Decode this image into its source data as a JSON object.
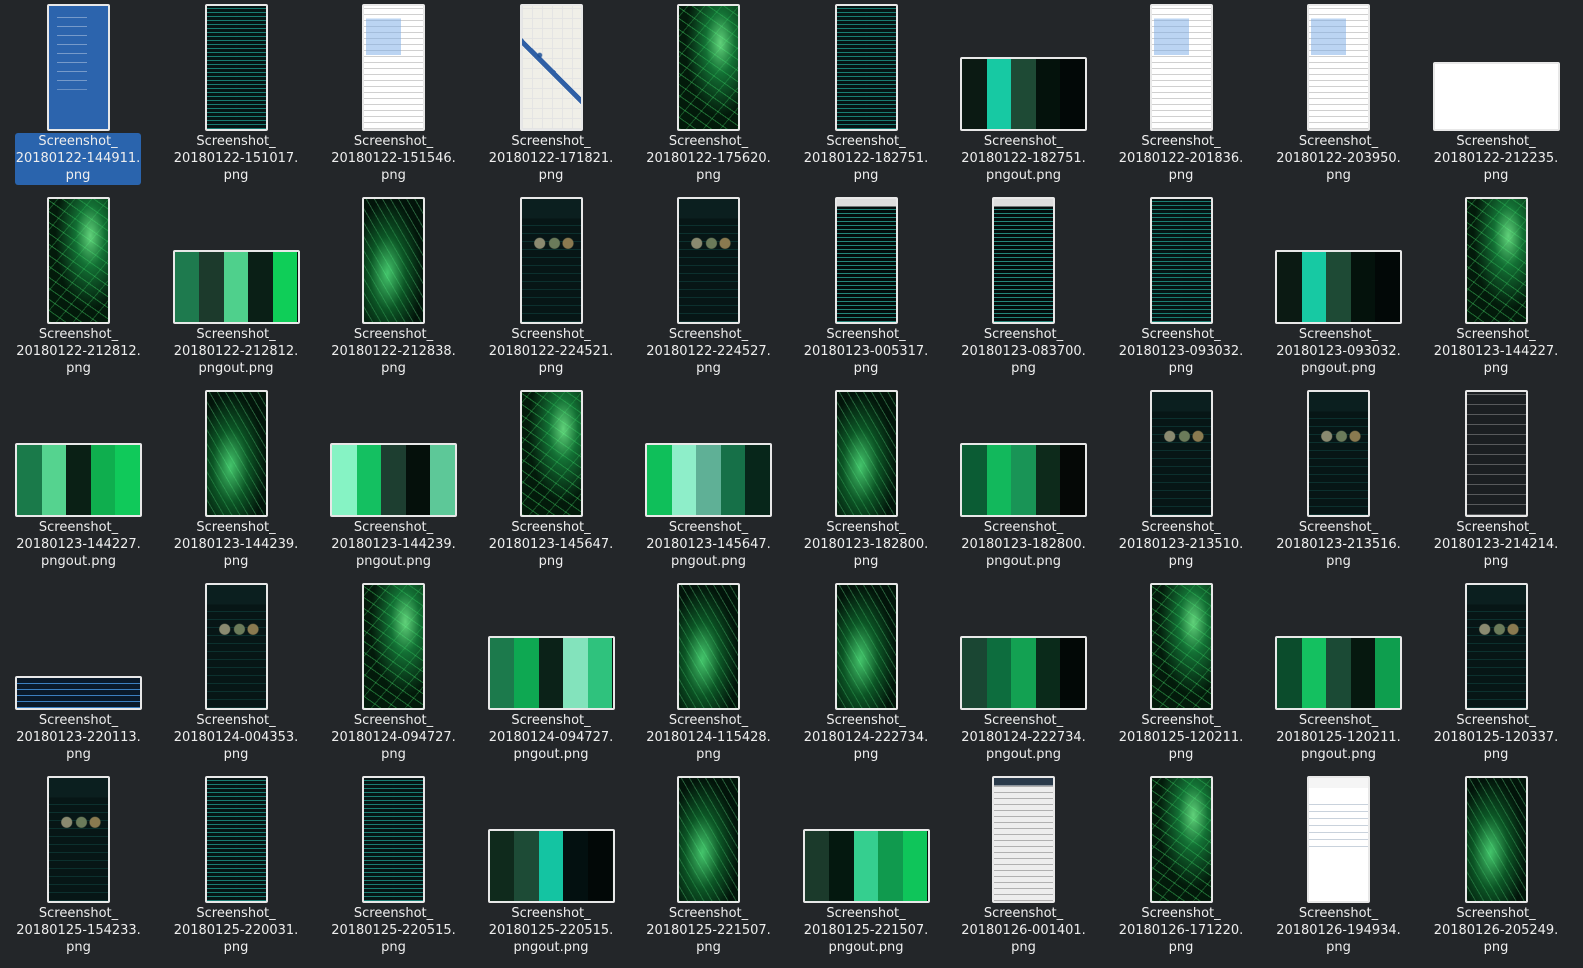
{
  "files": [
    {
      "name": [
        "Screenshot_",
        "20180122-144911.",
        "png"
      ],
      "thumb": "blue",
      "selected": true
    },
    {
      "name": [
        "Screenshot_",
        "20180122-151017.",
        "png"
      ],
      "thumb": "list"
    },
    {
      "name": [
        "Screenshot_",
        "20180122-151546.",
        "png"
      ],
      "thumb": "chartdoc"
    },
    {
      "name": [
        "Screenshot_",
        "20180122-171821.",
        "png"
      ],
      "thumb": "map"
    },
    {
      "name": [
        "Screenshot_",
        "20180122-175620.",
        "png"
      ],
      "thumb": "game"
    },
    {
      "name": [
        "Screenshot_",
        "20180122-182751.",
        "png"
      ],
      "thumb": "list"
    },
    {
      "name": [
        "Screenshot_",
        "20180122-182751.",
        "pngout.png"
      ],
      "thumb": "palette",
      "colors": [
        "#0b1a13",
        "#17c9a3",
        "#1e4a35",
        "#04120c",
        "#020807"
      ]
    },
    {
      "name": [
        "Screenshot_",
        "20180122-201836.",
        "png"
      ],
      "thumb": "chartdoc"
    },
    {
      "name": [
        "Screenshot_",
        "20180122-203950.",
        "png"
      ],
      "thumb": "chartdoc"
    },
    {
      "name": [
        "Screenshot_",
        "20180122-212235.",
        "png"
      ],
      "thumb": "doc"
    },
    {
      "name": [
        "Screenshot_",
        "20180122-212812.",
        "png"
      ],
      "thumb": "game"
    },
    {
      "name": [
        "Screenshot_",
        "20180122-212812.",
        "pngout.png"
      ],
      "thumb": "palette",
      "colors": [
        "#1e7a4e",
        "#1c3a2c",
        "#4fd08c",
        "#0a1f16",
        "#0fce58"
      ]
    },
    {
      "name": [
        "Screenshot_",
        "20180122-212838.",
        "png"
      ],
      "thumb": "game2"
    },
    {
      "name": [
        "Screenshot_",
        "20180122-224521.",
        "png"
      ],
      "thumb": "profile"
    },
    {
      "name": [
        "Screenshot_",
        "20180122-224527.",
        "png"
      ],
      "thumb": "profile"
    },
    {
      "name": [
        "Screenshot_",
        "20180123-005317.",
        "png"
      ],
      "thumb": "console"
    },
    {
      "name": [
        "Screenshot_",
        "20180123-083700.",
        "png"
      ],
      "thumb": "console"
    },
    {
      "name": [
        "Screenshot_",
        "20180123-093032.",
        "png"
      ],
      "thumb": "list"
    },
    {
      "name": [
        "Screenshot_",
        "20180123-093032.",
        "pngout.png"
      ],
      "thumb": "palette",
      "colors": [
        "#0b1a13",
        "#17c9a3",
        "#1e4a35",
        "#04120c",
        "#020807"
      ]
    },
    {
      "name": [
        "Screenshot_",
        "20180123-144227.",
        "png"
      ],
      "thumb": "game"
    },
    {
      "name": [
        "Screenshot_",
        "20180123-144227.",
        "pngout.png"
      ],
      "thumb": "palette",
      "colors": [
        "#1a7a4a",
        "#55d38f",
        "#0a2015",
        "#0fae4e",
        "#10c95a"
      ]
    },
    {
      "name": [
        "Screenshot_",
        "20180123-144239.",
        "png"
      ],
      "thumb": "game2"
    },
    {
      "name": [
        "Screenshot_",
        "20180123-144239.",
        "pngout.png"
      ],
      "thumb": "palette",
      "colors": [
        "#86f3c4",
        "#14c061",
        "#1d3e30",
        "#05100b",
        "#5dc898"
      ]
    },
    {
      "name": [
        "Screenshot_",
        "20180123-145647.",
        "png"
      ],
      "thumb": "game"
    },
    {
      "name": [
        "Screenshot_",
        "20180123-145647.",
        "pngout.png"
      ],
      "thumb": "palette",
      "colors": [
        "#0fbf5a",
        "#8eeec9",
        "#5fb096",
        "#167048",
        "#07261a"
      ]
    },
    {
      "name": [
        "Screenshot_",
        "20180123-182800.",
        "png"
      ],
      "thumb": "game2"
    },
    {
      "name": [
        "Screenshot_",
        "20180123-182800.",
        "pngout.png"
      ],
      "thumb": "palette",
      "colors": [
        "#0b5c34",
        "#12b85c",
        "#199456",
        "#0d2a1b",
        "#050806"
      ]
    },
    {
      "name": [
        "Screenshot_",
        "20180123-213510.",
        "png"
      ],
      "thumb": "profile"
    },
    {
      "name": [
        "Screenshot_",
        "20180123-213516.",
        "png"
      ],
      "thumb": "profile"
    },
    {
      "name": [
        "Screenshot_",
        "20180123-214214.",
        "png"
      ],
      "thumb": "chat"
    },
    {
      "name": [
        "Screenshot_",
        "20180123-220113.",
        "png"
      ],
      "thumb": "banner"
    },
    {
      "name": [
        "Screenshot_",
        "20180124-004353.",
        "png"
      ],
      "thumb": "profile"
    },
    {
      "name": [
        "Screenshot_",
        "20180124-094727.",
        "png"
      ],
      "thumb": "game"
    },
    {
      "name": [
        "Screenshot_",
        "20180124-094727.",
        "pngout.png"
      ],
      "thumb": "palette",
      "colors": [
        "#1c7a4c",
        "#0ea852",
        "#0b2218",
        "#83e3bc",
        "#2fc27d"
      ]
    },
    {
      "name": [
        "Screenshot_",
        "20180124-115428.",
        "png"
      ],
      "thumb": "game2"
    },
    {
      "name": [
        "Screenshot_",
        "20180124-222734.",
        "png"
      ],
      "thumb": "game2"
    },
    {
      "name": [
        "Screenshot_",
        "20180124-222734.",
        "pngout.png"
      ],
      "thumb": "palette",
      "colors": [
        "#1a4633",
        "#0d6d3e",
        "#13a152",
        "#0a2a1a",
        "#020806"
      ]
    },
    {
      "name": [
        "Screenshot_",
        "20180125-120211.",
        "png"
      ],
      "thumb": "game"
    },
    {
      "name": [
        "Screenshot_",
        "20180125-120211.",
        "pngout.png"
      ],
      "thumb": "palette",
      "colors": [
        "#0b4c2c",
        "#14c060",
        "#1b4a35",
        "#06180f",
        "#0e9e4e"
      ]
    },
    {
      "name": [
        "Screenshot_",
        "20180125-120337.",
        "png"
      ],
      "thumb": "profile"
    },
    {
      "name": [
        "Screenshot_",
        "20180125-154233.",
        "png"
      ],
      "thumb": "profile"
    },
    {
      "name": [
        "Screenshot_",
        "20180125-220031.",
        "png"
      ],
      "thumb": "list"
    },
    {
      "name": [
        "Screenshot_",
        "20180125-220515.",
        "png"
      ],
      "thumb": "list"
    },
    {
      "name": [
        "Screenshot_",
        "20180125-220515.",
        "pngout.png"
      ],
      "thumb": "palette",
      "colors": [
        "#0f2a1c",
        "#1d4b36",
        "#14c4a2",
        "#031010",
        "#020807"
      ]
    },
    {
      "name": [
        "Screenshot_",
        "20180125-221507.",
        "png"
      ],
      "thumb": "game2"
    },
    {
      "name": [
        "Screenshot_",
        "20180125-221507.",
        "pngout.png"
      ],
      "thumb": "palette",
      "colors": [
        "#1b3a2b",
        "#04180f",
        "#35cf8f",
        "#109a4e",
        "#0fc55a"
      ]
    },
    {
      "name": [
        "Screenshot_",
        "20180126-001401.",
        "png"
      ],
      "thumb": "lightlist"
    },
    {
      "name": [
        "Screenshot_",
        "20180126-171220.",
        "png"
      ],
      "thumb": "game"
    },
    {
      "name": [
        "Screenshot_",
        "20180126-194934.",
        "png"
      ],
      "thumb": "doc"
    },
    {
      "name": [
        "Screenshot_",
        "20180126-205249.",
        "png"
      ],
      "thumb": "game2"
    }
  ]
}
